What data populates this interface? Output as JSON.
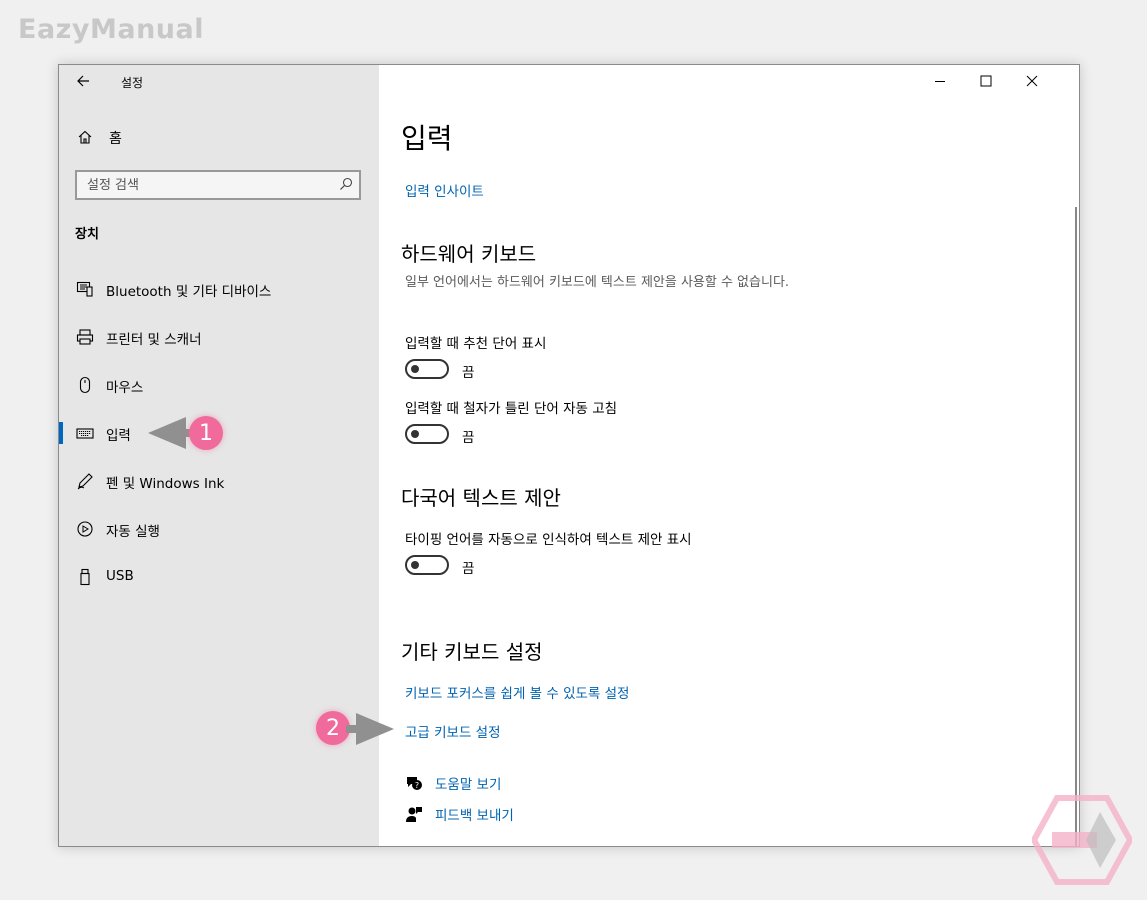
{
  "watermark": "EazyManual",
  "window": {
    "app_title": "설정",
    "controls": {
      "minimize": "minimize-icon",
      "maximize": "maximize-icon",
      "close": "close-icon"
    }
  },
  "sidebar": {
    "home_label": "홈",
    "search_placeholder": "설정 검색",
    "group_title": "장치",
    "items": [
      {
        "label": "Bluetooth 및 기타 디바이스",
        "icon": "bluetooth-devices-icon",
        "active": false
      },
      {
        "label": "프린터 및 스캐너",
        "icon": "printer-icon",
        "active": false
      },
      {
        "label": "마우스",
        "icon": "mouse-icon",
        "active": false
      },
      {
        "label": "입력",
        "icon": "keyboard-icon",
        "active": true
      },
      {
        "label": "펜 및 Windows Ink",
        "icon": "pen-icon",
        "active": false
      },
      {
        "label": "자동 실행",
        "icon": "autoplay-icon",
        "active": false
      },
      {
        "label": "USB",
        "icon": "usb-icon",
        "active": false
      }
    ]
  },
  "main": {
    "title": "입력",
    "insight_link": "입력 인사이트",
    "hardware": {
      "title": "하드웨어 키보드",
      "description": "일부 언어에서는 하드웨어 키보드에 텍스트 제안을 사용할 수 없습니다.",
      "setting1": {
        "label": "입력할 때 추천 단어 표시",
        "state": "끔"
      },
      "setting2": {
        "label": "입력할 때 철자가 틀린 단어 자동 고침",
        "state": "끔"
      }
    },
    "multilingual": {
      "title": "다국어 텍스트 제안",
      "setting": {
        "label": "타이핑 언어를 자동으로 인식하여 텍스트 제안 표시",
        "state": "끔"
      }
    },
    "other": {
      "title": "기타 키보드 설정",
      "link1": "키보드 포커스를 쉽게 볼 수 있도록 설정",
      "link2": "고급 키보드 설정"
    },
    "help": {
      "get_help": "도움말 보기",
      "feedback": "피드백 보내기"
    }
  },
  "annotations": {
    "badge1": "1",
    "badge2": "2",
    "color": "#f06b9b"
  },
  "colors": {
    "accent": "#0067c0",
    "link": "#0063b1",
    "sidebar_bg": "#e6e6e6"
  }
}
